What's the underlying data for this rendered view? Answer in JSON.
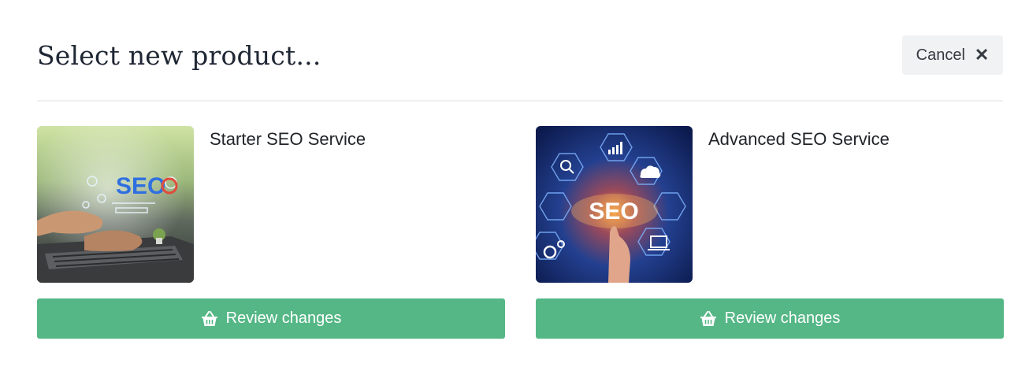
{
  "header": {
    "title": "Select new product...",
    "cancel_label": "Cancel",
    "cancel_icon": "close-icon"
  },
  "products": [
    {
      "name": "Starter SEO Service",
      "image_icon": "seo-laptop-image",
      "button_label": "Review changes",
      "button_icon": "basket-icon"
    },
    {
      "name": "Advanced SEO Service",
      "image_icon": "seo-network-image",
      "button_label": "Review changes",
      "button_icon": "basket-icon"
    }
  ],
  "image_text": {
    "starter": "SEO",
    "advanced": "SEO"
  },
  "colors": {
    "button_green": "#55b786",
    "cancel_bg": "#f1f2f4",
    "divider": "#eef0f2"
  }
}
